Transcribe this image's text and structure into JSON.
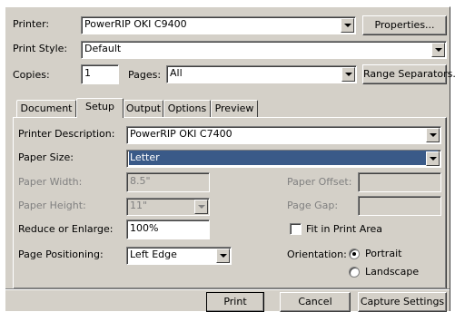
{
  "printer": {
    "label": "Printer:",
    "value": "PowerRIP OKI C9400",
    "properties_button": "Properties..."
  },
  "print_style": {
    "label": "Print Style:",
    "value": "Default"
  },
  "copies": {
    "label": "Copies:",
    "value": "1"
  },
  "pages": {
    "label": "Pages:",
    "value": "All",
    "range_separators_button": "Range Separators..."
  },
  "tabs": [
    {
      "label": "Document",
      "active": false
    },
    {
      "label": "Setup",
      "active": true
    },
    {
      "label": "Output",
      "active": false
    },
    {
      "label": "Options",
      "active": false
    },
    {
      "label": "Preview",
      "active": false
    }
  ],
  "setup": {
    "printer_description": {
      "label": "Printer Description:",
      "value": "PowerRIP OKI C7400"
    },
    "paper_size": {
      "label": "Paper Size:",
      "value": "Letter"
    },
    "paper_width": {
      "label": "Paper Width:",
      "value": "8.5\""
    },
    "paper_height": {
      "label": "Paper Height:",
      "value": "11\""
    },
    "paper_offset": {
      "label": "Paper Offset:",
      "value": ""
    },
    "page_gap": {
      "label": "Page Gap:",
      "value": ""
    },
    "reduce_enlarge": {
      "label": "Reduce or Enlarge:",
      "value": "100%"
    },
    "fit_in_print_area": {
      "label": "Fit in Print Area",
      "checked": false
    },
    "page_positioning": {
      "label": "Page Positioning:",
      "value": "Left Edge"
    },
    "orientation": {
      "label": "Orientation:",
      "options": [
        {
          "label": "Portrait",
          "selected": true
        },
        {
          "label": "Landscape",
          "selected": false
        }
      ]
    }
  },
  "footer": {
    "print": "Print",
    "cancel": "Cancel",
    "capture_settings": "Capture Settings"
  }
}
